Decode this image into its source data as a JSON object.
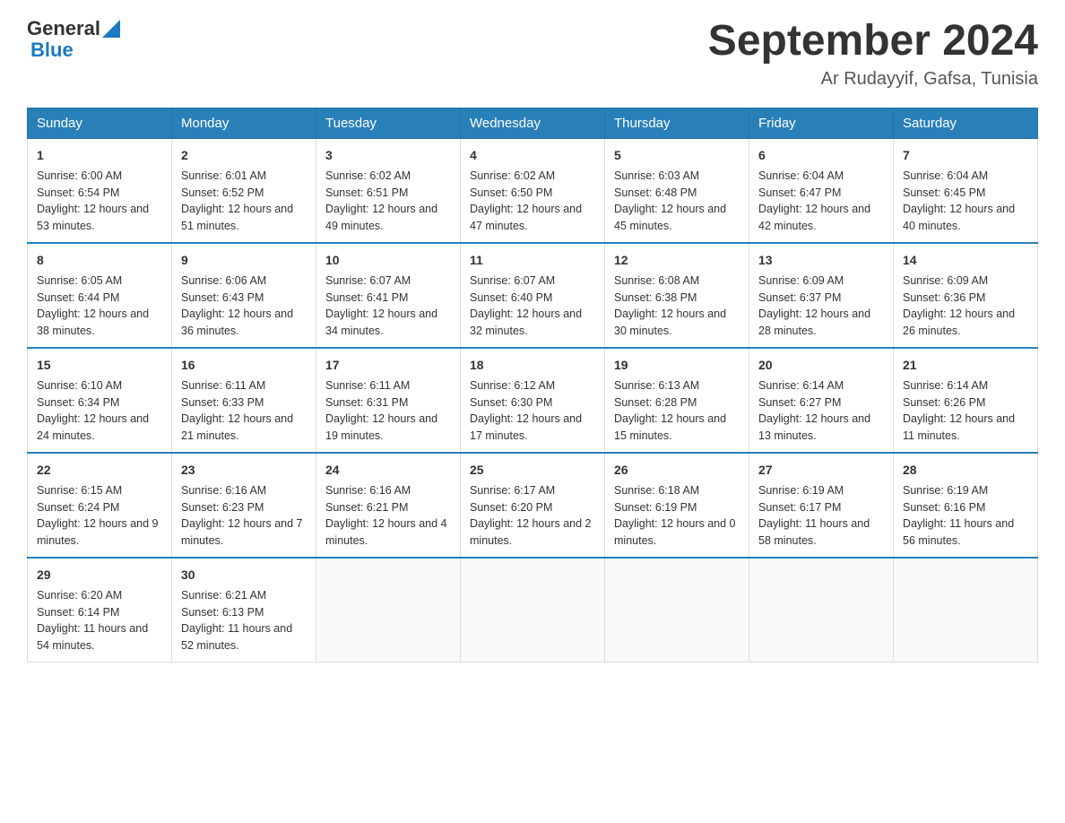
{
  "header": {
    "logo": {
      "general": "General",
      "arrow": "▲",
      "blue": "Blue"
    },
    "title": "September 2024",
    "subtitle": "Ar Rudayyif, Gafsa, Tunisia"
  },
  "days": [
    "Sunday",
    "Monday",
    "Tuesday",
    "Wednesday",
    "Thursday",
    "Friday",
    "Saturday"
  ],
  "weeks": [
    [
      {
        "day": "1",
        "sunrise": "6:00 AM",
        "sunset": "6:54 PM",
        "daylight": "12 hours and 53 minutes."
      },
      {
        "day": "2",
        "sunrise": "6:01 AM",
        "sunset": "6:52 PM",
        "daylight": "12 hours and 51 minutes."
      },
      {
        "day": "3",
        "sunrise": "6:02 AM",
        "sunset": "6:51 PM",
        "daylight": "12 hours and 49 minutes."
      },
      {
        "day": "4",
        "sunrise": "6:02 AM",
        "sunset": "6:50 PM",
        "daylight": "12 hours and 47 minutes."
      },
      {
        "day": "5",
        "sunrise": "6:03 AM",
        "sunset": "6:48 PM",
        "daylight": "12 hours and 45 minutes."
      },
      {
        "day": "6",
        "sunrise": "6:04 AM",
        "sunset": "6:47 PM",
        "daylight": "12 hours and 42 minutes."
      },
      {
        "day": "7",
        "sunrise": "6:04 AM",
        "sunset": "6:45 PM",
        "daylight": "12 hours and 40 minutes."
      }
    ],
    [
      {
        "day": "8",
        "sunrise": "6:05 AM",
        "sunset": "6:44 PM",
        "daylight": "12 hours and 38 minutes."
      },
      {
        "day": "9",
        "sunrise": "6:06 AM",
        "sunset": "6:43 PM",
        "daylight": "12 hours and 36 minutes."
      },
      {
        "day": "10",
        "sunrise": "6:07 AM",
        "sunset": "6:41 PM",
        "daylight": "12 hours and 34 minutes."
      },
      {
        "day": "11",
        "sunrise": "6:07 AM",
        "sunset": "6:40 PM",
        "daylight": "12 hours and 32 minutes."
      },
      {
        "day": "12",
        "sunrise": "6:08 AM",
        "sunset": "6:38 PM",
        "daylight": "12 hours and 30 minutes."
      },
      {
        "day": "13",
        "sunrise": "6:09 AM",
        "sunset": "6:37 PM",
        "daylight": "12 hours and 28 minutes."
      },
      {
        "day": "14",
        "sunrise": "6:09 AM",
        "sunset": "6:36 PM",
        "daylight": "12 hours and 26 minutes."
      }
    ],
    [
      {
        "day": "15",
        "sunrise": "6:10 AM",
        "sunset": "6:34 PM",
        "daylight": "12 hours and 24 minutes."
      },
      {
        "day": "16",
        "sunrise": "6:11 AM",
        "sunset": "6:33 PM",
        "daylight": "12 hours and 21 minutes."
      },
      {
        "day": "17",
        "sunrise": "6:11 AM",
        "sunset": "6:31 PM",
        "daylight": "12 hours and 19 minutes."
      },
      {
        "day": "18",
        "sunrise": "6:12 AM",
        "sunset": "6:30 PM",
        "daylight": "12 hours and 17 minutes."
      },
      {
        "day": "19",
        "sunrise": "6:13 AM",
        "sunset": "6:28 PM",
        "daylight": "12 hours and 15 minutes."
      },
      {
        "day": "20",
        "sunrise": "6:14 AM",
        "sunset": "6:27 PM",
        "daylight": "12 hours and 13 minutes."
      },
      {
        "day": "21",
        "sunrise": "6:14 AM",
        "sunset": "6:26 PM",
        "daylight": "12 hours and 11 minutes."
      }
    ],
    [
      {
        "day": "22",
        "sunrise": "6:15 AM",
        "sunset": "6:24 PM",
        "daylight": "12 hours and 9 minutes."
      },
      {
        "day": "23",
        "sunrise": "6:16 AM",
        "sunset": "6:23 PM",
        "daylight": "12 hours and 7 minutes."
      },
      {
        "day": "24",
        "sunrise": "6:16 AM",
        "sunset": "6:21 PM",
        "daylight": "12 hours and 4 minutes."
      },
      {
        "day": "25",
        "sunrise": "6:17 AM",
        "sunset": "6:20 PM",
        "daylight": "12 hours and 2 minutes."
      },
      {
        "day": "26",
        "sunrise": "6:18 AM",
        "sunset": "6:19 PM",
        "daylight": "12 hours and 0 minutes."
      },
      {
        "day": "27",
        "sunrise": "6:19 AM",
        "sunset": "6:17 PM",
        "daylight": "11 hours and 58 minutes."
      },
      {
        "day": "28",
        "sunrise": "6:19 AM",
        "sunset": "6:16 PM",
        "daylight": "11 hours and 56 minutes."
      }
    ],
    [
      {
        "day": "29",
        "sunrise": "6:20 AM",
        "sunset": "6:14 PM",
        "daylight": "11 hours and 54 minutes."
      },
      {
        "day": "30",
        "sunrise": "6:21 AM",
        "sunset": "6:13 PM",
        "daylight": "11 hours and 52 minutes."
      },
      null,
      null,
      null,
      null,
      null
    ]
  ]
}
